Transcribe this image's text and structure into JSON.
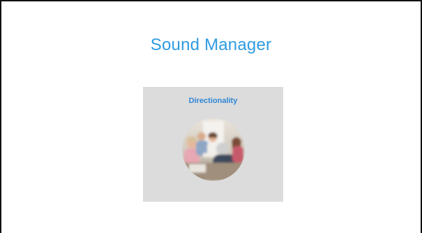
{
  "slide": {
    "title": "Sound Manager"
  },
  "card": {
    "label": "Directionality",
    "image": "group-conversation-photo"
  },
  "colors": {
    "title": "#2f9be0",
    "card_label": "#2f86d6",
    "card_background": "#dcdcdc",
    "frame_border": "#111111"
  }
}
